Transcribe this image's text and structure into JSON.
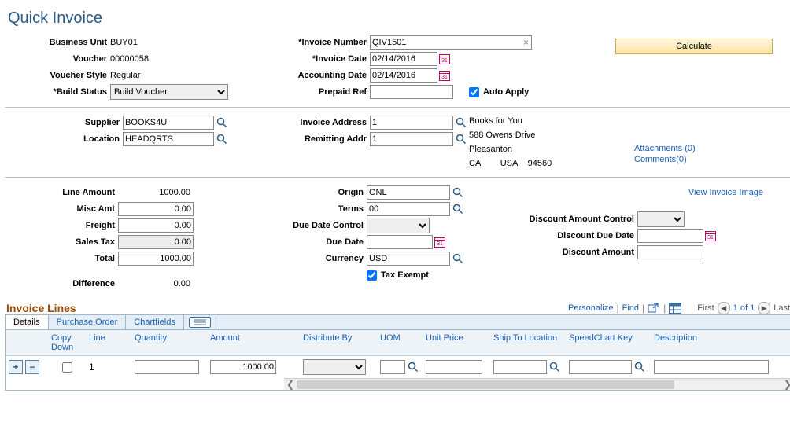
{
  "title": "Quick Invoice",
  "header": {
    "business_unit_lbl": "Business Unit",
    "business_unit": "BUY01",
    "voucher_lbl": "Voucher",
    "voucher": "00000058",
    "voucher_style_lbl": "Voucher Style",
    "voucher_style": "Regular",
    "build_status_lbl": "*Build Status",
    "build_status": "Build Voucher",
    "invoice_number_lbl": "*Invoice Number",
    "invoice_number": "QIV1501",
    "invoice_date_lbl": "*Invoice Date",
    "invoice_date": "02/14/2016",
    "accounting_date_lbl": "Accounting Date",
    "accounting_date": "02/14/2016",
    "prepaid_ref_lbl": "Prepaid Ref",
    "prepaid_ref": "",
    "auto_apply_lbl": "Auto Apply",
    "calculate_btn": "Calculate"
  },
  "supplier": {
    "supplier_lbl": "Supplier",
    "supplier": "BOOKS4U",
    "location_lbl": "Location",
    "location": "HEADQRTS",
    "invoice_address_lbl": "Invoice Address",
    "invoice_address": "1",
    "remitting_addr_lbl": "Remitting Addr",
    "remitting_addr": "1",
    "addr_name": "Books for You",
    "addr_line1": "588 Owens Drive",
    "addr_city": "Pleasanton",
    "addr_state": "CA",
    "addr_country": "USA",
    "addr_postal": "94560",
    "attachments_link": "Attachments (0)",
    "comments_link": "Comments(0)"
  },
  "amounts": {
    "line_amount_lbl": "Line Amount",
    "line_amount": "1000.00",
    "misc_amt_lbl": "Misc Amt",
    "misc_amt": "0.00",
    "freight_lbl": "Freight",
    "freight": "0.00",
    "sales_tax_lbl": "Sales Tax",
    "sales_tax": "0.00",
    "total_lbl": "Total",
    "total": "1000.00",
    "difference_lbl": "Difference",
    "difference": "0.00",
    "origin_lbl": "Origin",
    "origin": "ONL",
    "terms_lbl": "Terms",
    "terms": "00",
    "due_date_control_lbl": "Due Date Control",
    "due_date_control": "",
    "due_date_lbl": "Due Date",
    "due_date": "",
    "currency_lbl": "Currency",
    "currency": "USD",
    "tax_exempt_lbl": "Tax Exempt",
    "discount_amount_control_lbl": "Discount Amount Control",
    "discount_amount_control": "",
    "discount_due_date_lbl": "Discount Due Date",
    "discount_due_date": "",
    "discount_amount_lbl": "Discount Amount",
    "discount_amount": "",
    "view_invoice_image_link": "View Invoice Image"
  },
  "grid": {
    "title": "Invoice Lines",
    "personalize": "Personalize",
    "find": "Find",
    "first": "First",
    "counter": "1 of 1",
    "last": "Last",
    "tabs": {
      "details": "Details",
      "po": "Purchase Order",
      "chartfields": "Chartfields"
    },
    "columns": {
      "copy_down": "Copy Down",
      "line": "Line",
      "quantity": "Quantity",
      "amount": "Amount",
      "distribute_by": "Distribute By",
      "uom": "UOM",
      "unit_price": "Unit Price",
      "ship_to": "Ship To Location",
      "speedchart": "SpeedChart Key",
      "description": "Description"
    },
    "rows": [
      {
        "line": "1",
        "quantity": "",
        "amount": "1000.00",
        "distribute_by": "",
        "uom": "",
        "unit_price": "",
        "ship_to": "",
        "speedchart": "",
        "description": ""
      }
    ]
  }
}
